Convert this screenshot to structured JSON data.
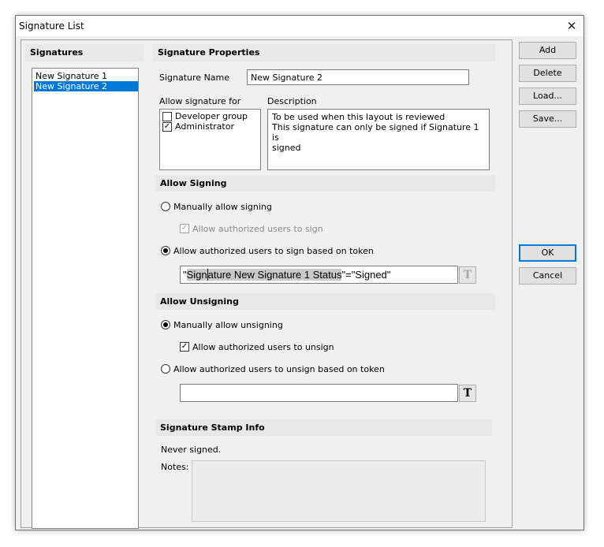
{
  "window": {
    "title": "Signature List"
  },
  "signatures": {
    "header": "Signatures",
    "items": [
      {
        "label": "New Signature 1"
      },
      {
        "label": "New Signature 2"
      }
    ]
  },
  "properties": {
    "header": "Signature Properties",
    "name_label": "Signature Name",
    "name_value": "New Signature 2",
    "allow_for_label": "Allow signature for",
    "groups": [
      {
        "label": "Developer group",
        "checked": false
      },
      {
        "label": "Administrator",
        "checked": true
      }
    ],
    "description_label": "Description",
    "description_lines": [
      "To be used when this layout is reviewed",
      "This signature can only be signed if Signature 1 is",
      "signed"
    ]
  },
  "allow_signing": {
    "header": "Allow Signing",
    "manual_label": "Manually allow signing",
    "auth_users_label": "Allow authorized users to sign",
    "token_label": "Allow authorized users to sign based on token",
    "token_expr_pre": "\"",
    "token_expr_hl1": "Sign",
    "token_expr_hl2": "ature New Signature 1 Status",
    "token_expr_post": "\"=\"Signed\"",
    "token_btn": "T"
  },
  "allow_unsigning": {
    "header": "Allow Unsigning",
    "manual_label": "Manually allow unsigning",
    "auth_users_label": "Allow authorized users to unsign",
    "token_label": "Allow authorized users to unsign based on token",
    "token_value": "",
    "token_btn": "T"
  },
  "stamp": {
    "header": "Signature Stamp Info",
    "status": "Never signed.",
    "notes_label": "Notes:"
  },
  "buttons": {
    "add": "Add",
    "delete": "Delete",
    "load": "Load...",
    "save": "Save...",
    "ok": "OK",
    "cancel": "Cancel"
  }
}
